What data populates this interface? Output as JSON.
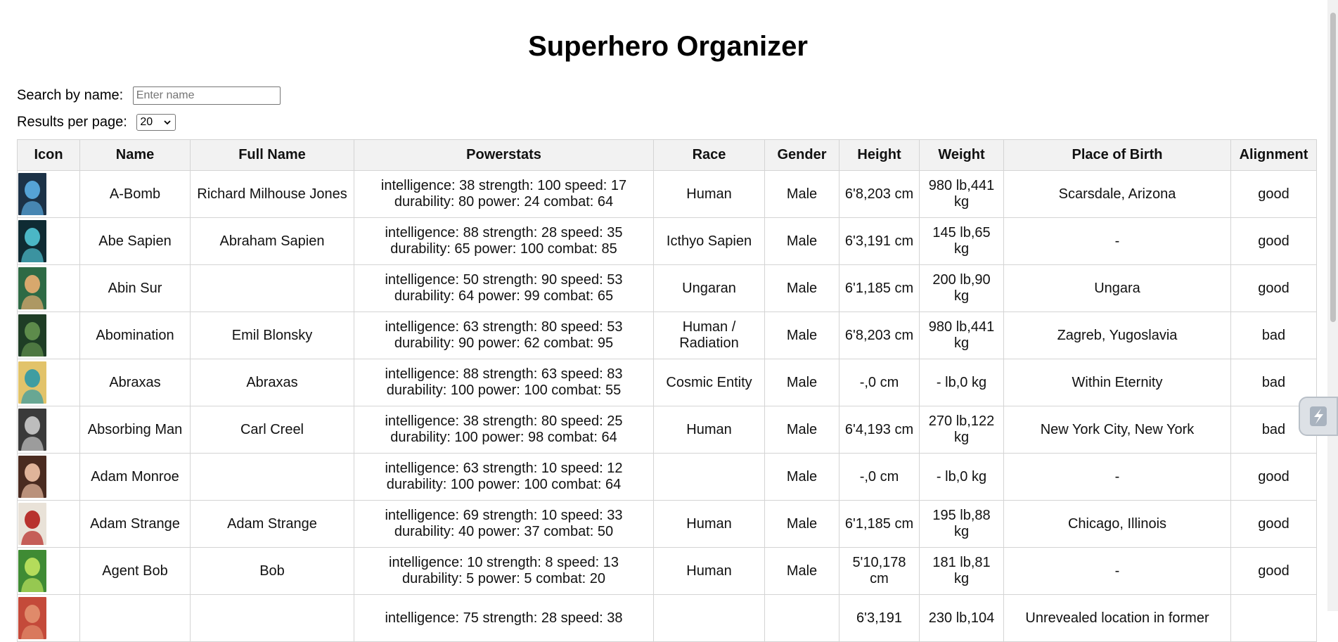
{
  "page": {
    "title": "Superhero Organizer"
  },
  "search": {
    "label": "Search by name:",
    "placeholder": "Enter name",
    "value": ""
  },
  "pagination": {
    "label": "Results per page:",
    "selected": "20"
  },
  "table": {
    "headers": [
      "Icon",
      "Name",
      "Full Name",
      "Powerstats",
      "Race",
      "Gender",
      "Height",
      "Weight",
      "Place of Birth",
      "Alignment"
    ],
    "rows": [
      {
        "name": "A-Bomb",
        "full_name": "Richard Milhouse Jones",
        "powerstats": "intelligence: 38 strength: 100 speed: 17 durability: 80 power: 24 combat: 64",
        "race": "Human",
        "gender": "Male",
        "height": "6'8,203 cm",
        "weight": "980 lb,441 kg",
        "birthplace": "Scarsdale, Arizona",
        "alignment": "good",
        "icon_colors": [
          "#1c3247",
          "#55a3d6"
        ]
      },
      {
        "name": "Abe Sapien",
        "full_name": "Abraham Sapien",
        "powerstats": "intelligence: 88 strength: 28 speed: 35 durability: 65 power: 100 combat: 85",
        "race": "Icthyo Sapien",
        "gender": "Male",
        "height": "6'3,191 cm",
        "weight": "145 lb,65 kg",
        "birthplace": "-",
        "alignment": "good",
        "icon_colors": [
          "#0f2b33",
          "#4bb7c6"
        ]
      },
      {
        "name": "Abin Sur",
        "full_name": "",
        "powerstats": "intelligence: 50 strength: 90 speed: 53 durability: 64 power: 99 combat: 65",
        "race": "Ungaran",
        "gender": "Male",
        "height": "6'1,185 cm",
        "weight": "200 lb,90 kg",
        "birthplace": "Ungara",
        "alignment": "good",
        "icon_colors": [
          "#2e6a45",
          "#d8a86d"
        ]
      },
      {
        "name": "Abomination",
        "full_name": "Emil Blonsky",
        "powerstats": "intelligence: 63 strength: 80 speed: 53 durability: 90 power: 62 combat: 95",
        "race": "Human / Radiation",
        "gender": "Male",
        "height": "6'8,203 cm",
        "weight": "980 lb,441 kg",
        "birthplace": "Zagreb, Yugoslavia",
        "alignment": "bad",
        "icon_colors": [
          "#1e3d25",
          "#5d8b4b"
        ]
      },
      {
        "name": "Abraxas",
        "full_name": "Abraxas",
        "powerstats": "intelligence: 88 strength: 63 speed: 83 durability: 100 power: 100 combat: 55",
        "race": "Cosmic Entity",
        "gender": "Male",
        "height": "-,0 cm",
        "weight": "- lb,0 kg",
        "birthplace": "Within Eternity",
        "alignment": "bad",
        "icon_colors": [
          "#e2c36a",
          "#3f9da1"
        ]
      },
      {
        "name": "Absorbing Man",
        "full_name": "Carl Creel",
        "powerstats": "intelligence: 38 strength: 80 speed: 25 durability: 100 power: 98 combat: 64",
        "race": "Human",
        "gender": "Male",
        "height": "6'4,193 cm",
        "weight": "270 lb,122 kg",
        "birthplace": "New York City, New York",
        "alignment": "bad",
        "icon_colors": [
          "#3a3a3a",
          "#bdbdbd"
        ]
      },
      {
        "name": "Adam Monroe",
        "full_name": "",
        "powerstats": "intelligence: 63 strength: 10 speed: 12 durability: 100 power: 100 combat: 64",
        "race": "",
        "gender": "Male",
        "height": "-,0 cm",
        "weight": "- lb,0 kg",
        "birthplace": "-",
        "alignment": "good",
        "icon_colors": [
          "#4a2b20",
          "#e0b49a"
        ]
      },
      {
        "name": "Adam Strange",
        "full_name": "Adam Strange",
        "powerstats": "intelligence: 69 strength: 10 speed: 33 durability: 40 power: 37 combat: 50",
        "race": "Human",
        "gender": "Male",
        "height": "6'1,185 cm",
        "weight": "195 lb,88 kg",
        "birthplace": "Chicago, Illinois",
        "alignment": "good",
        "icon_colors": [
          "#e9e2d8",
          "#b8322e"
        ]
      },
      {
        "name": "Agent Bob",
        "full_name": "Bob",
        "powerstats": "intelligence: 10 strength: 8 speed: 13 durability: 5 power: 5 combat: 20",
        "race": "Human",
        "gender": "Male",
        "height": "5'10,178 cm",
        "weight": "181 lb,81 kg",
        "birthplace": "-",
        "alignment": "good",
        "icon_colors": [
          "#3f8b34",
          "#b4dc5b"
        ]
      },
      {
        "name": "",
        "full_name": "",
        "powerstats": "intelligence: 75 strength: 28 speed: 38",
        "race": "",
        "gender": "",
        "height": "6'3,191",
        "weight": "230 lb,104",
        "birthplace": "Unrevealed location in former",
        "alignment": "",
        "icon_colors": [
          "#c44a3a",
          "#e08a6a"
        ]
      }
    ]
  }
}
